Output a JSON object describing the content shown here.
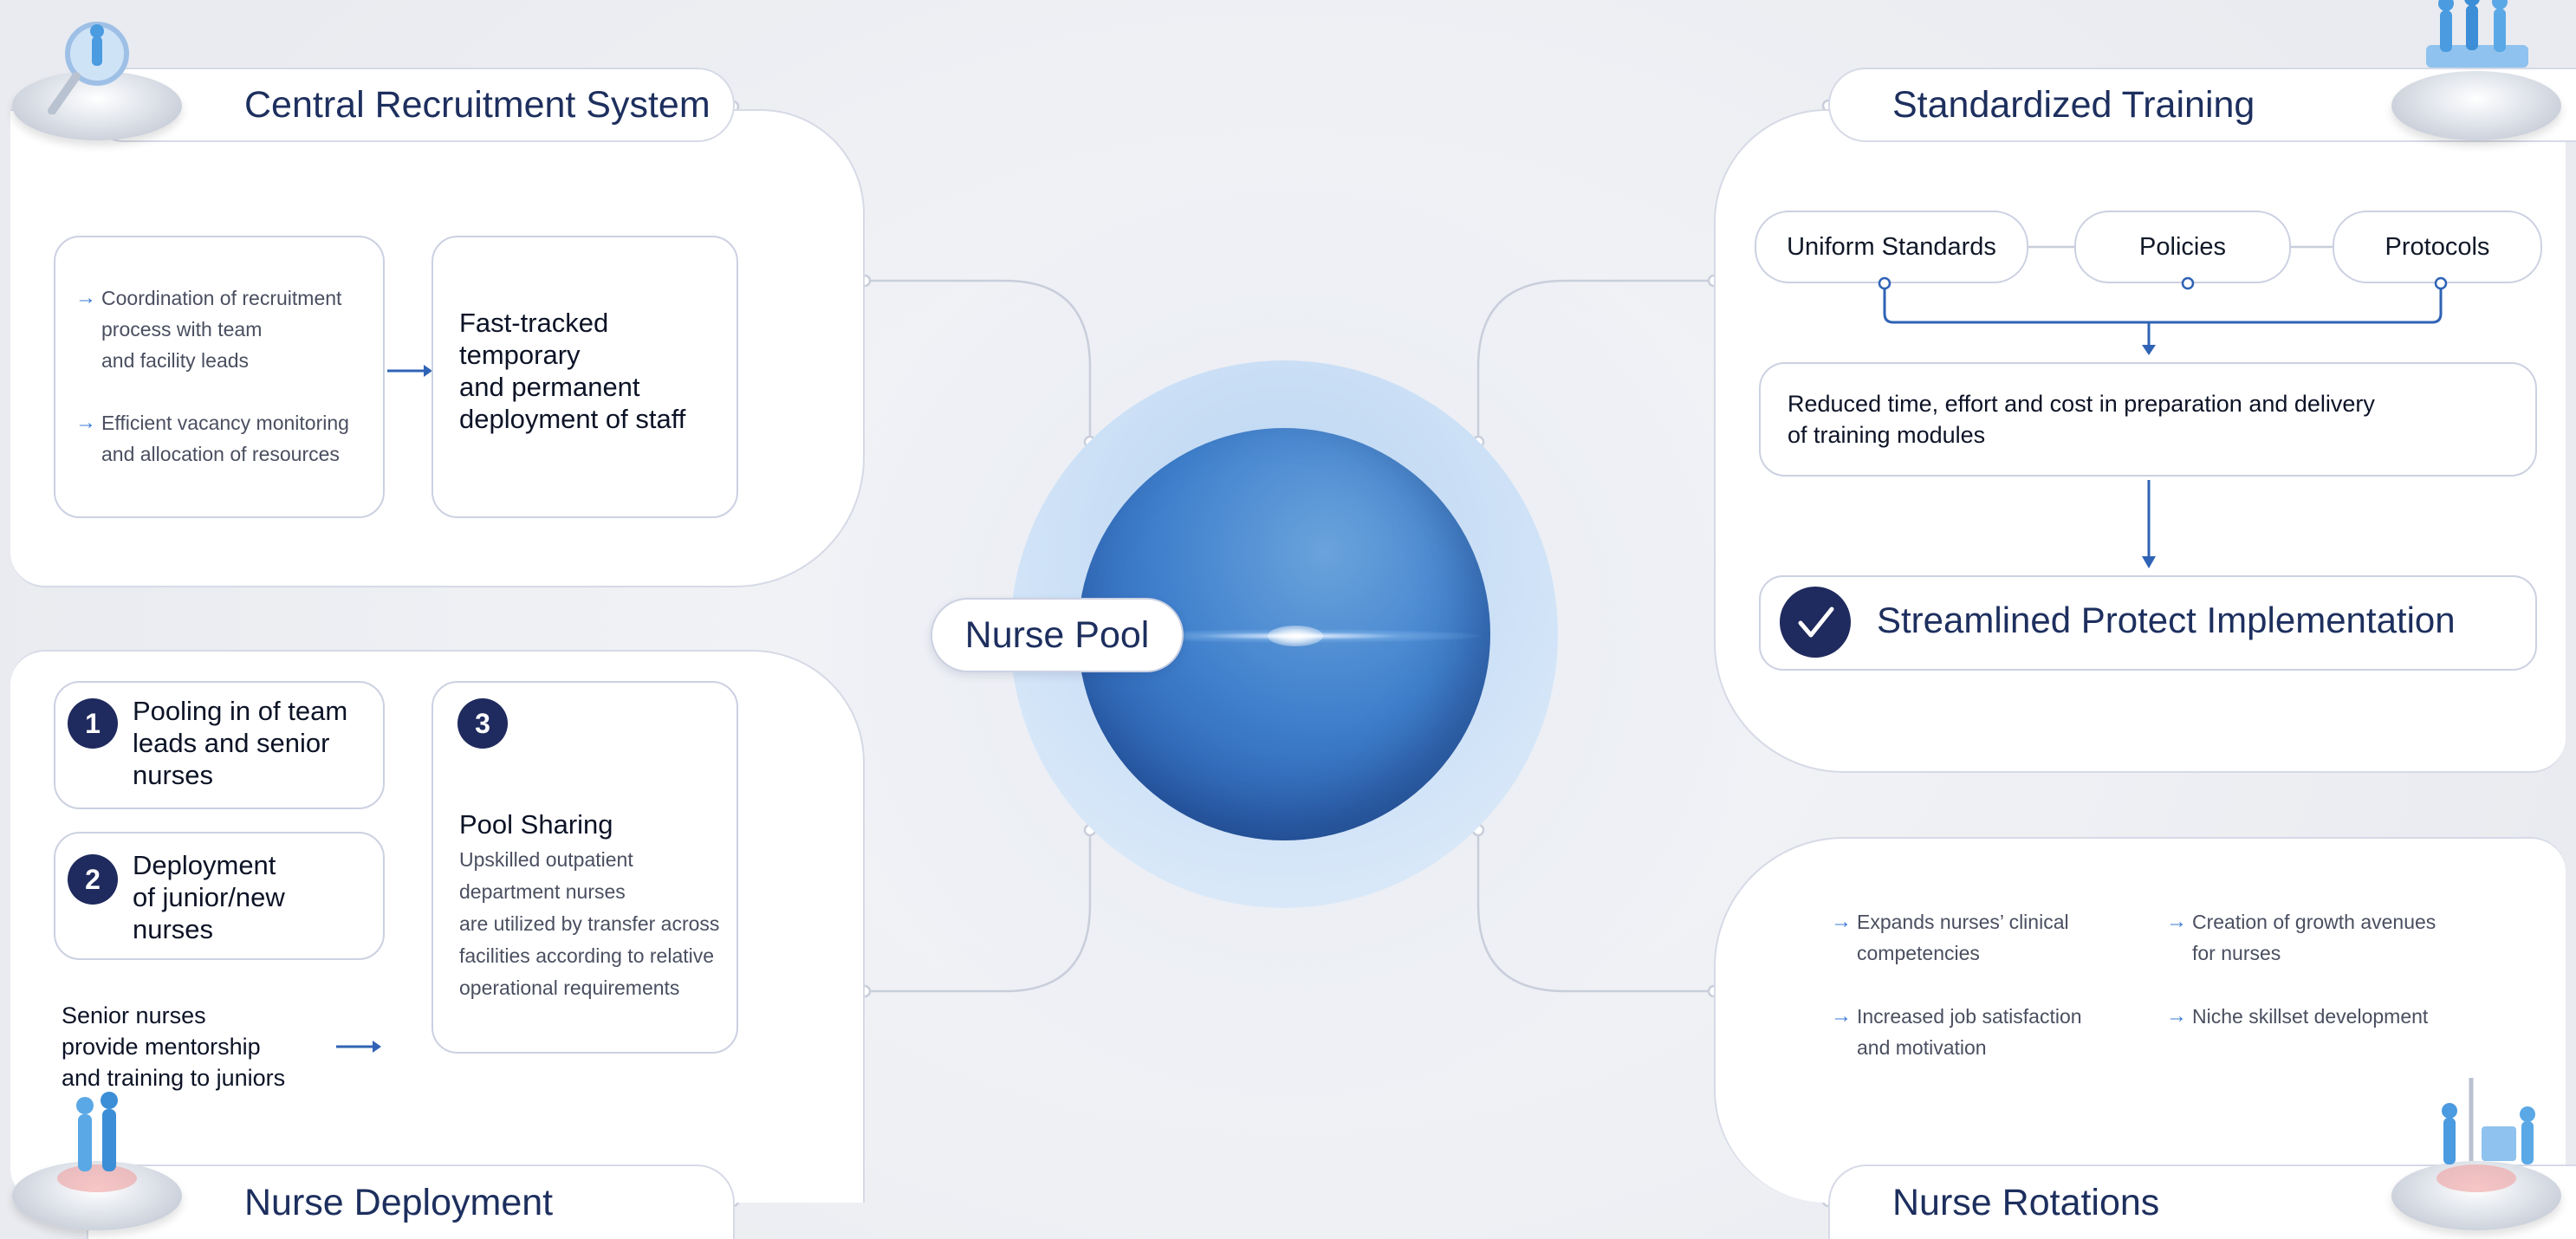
{
  "colors": {
    "navy": "#1f2a5e",
    "accent": "#2f63b5",
    "arrow": "#3a7bd5"
  },
  "center": {
    "label": "Nurse Pool"
  },
  "recruitment": {
    "title": "Central Recruitment System",
    "bullets": [
      [
        "Coordination of recruitment",
        "process with team",
        "and facility leads"
      ],
      [
        "Efficient vacancy monitoring",
        "and allocation of resources"
      ]
    ],
    "outcome": [
      "Fast-tracked",
      "temporary",
      "and permanent",
      "deployment of staff"
    ],
    "icon": "magnifier-nurse-icon"
  },
  "training": {
    "title": "Standardized Training",
    "pills": [
      "Uniform Standards",
      "Policies",
      "Protocols"
    ],
    "result": [
      "Reduced time, effort and cost in preparation and delivery",
      "of training modules"
    ],
    "final": "Streamlined Protect Implementation",
    "icon": "training-team-icon"
  },
  "deployment": {
    "title": "Nurse Deployment",
    "items": [
      {
        "num": "1",
        "lines": [
          "Pooling in of team",
          "leads and senior",
          "nurses"
        ]
      },
      {
        "num": "2",
        "lines": [
          "Deployment",
          "of junior/new",
          "nurses"
        ]
      }
    ],
    "pool": {
      "num": "3",
      "title": "Pool Sharing",
      "lines": [
        "Upskilled outpatient",
        "department nurses",
        "are utilized by transfer across",
        "facilities according to relative",
        "operational requirements"
      ]
    },
    "mentorship": [
      "Senior nurses",
      "provide mentorship",
      "and training to juniors"
    ],
    "icon": "nurses-meeting-icon"
  },
  "rotations": {
    "title": "Nurse Rotations",
    "bullets": [
      [
        "Expands nurses’ clinical",
        "competencies"
      ],
      [
        "Creation of growth avenues",
        "for nurses"
      ],
      [
        "Increased job satisfaction",
        "and motivation"
      ],
      [
        "Niche skillset development"
      ]
    ],
    "icon": "rotation-platform-icon"
  }
}
